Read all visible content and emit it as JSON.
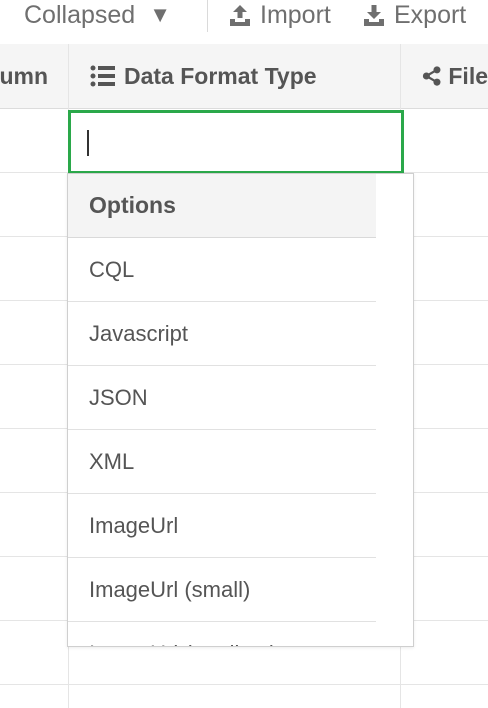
{
  "toolbar": {
    "collapsed_label": "Collapsed",
    "caret_glyph": "▼",
    "import_label": "Import",
    "export_label": "Export"
  },
  "table": {
    "prev_column_label": "umn",
    "main_column_label": "Data Format Type",
    "next_column_label": "File"
  },
  "editor": {
    "value": ""
  },
  "dropdown": {
    "header": "Options",
    "options": [
      "CQL",
      "Javascript",
      "JSON",
      "XML",
      "ImageUrl",
      "ImageUrl (small)",
      "ImageUrl (medium)"
    ]
  },
  "colors": {
    "focus_border": "#2aa84a",
    "header_bg": "#f5f5f5",
    "text": "#555555"
  }
}
